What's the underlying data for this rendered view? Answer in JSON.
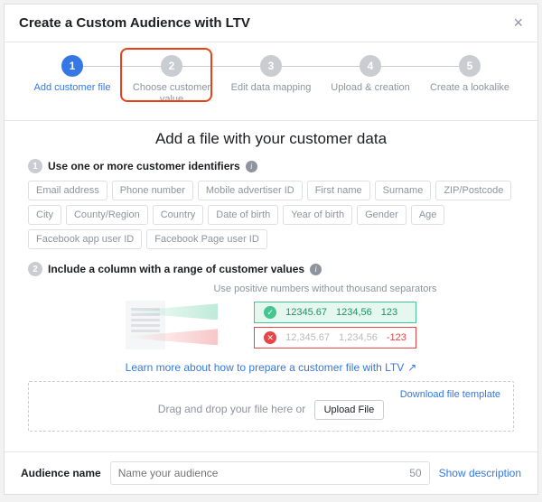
{
  "header": {
    "title": "Create a Custom Audience with LTV"
  },
  "steps": [
    {
      "label": "Add customer file"
    },
    {
      "label": "Choose customer value"
    },
    {
      "label": "Edit data mapping"
    },
    {
      "label": "Upload & creation"
    },
    {
      "label": "Create a lookalike"
    }
  ],
  "main": {
    "title": "Add a file with your customer data",
    "section1": "Use one or more customer identifiers",
    "chips": [
      "Email address",
      "Phone number",
      "Mobile advertiser ID",
      "First name",
      "Surname",
      "ZIP/Postcode",
      "City",
      "County/Region",
      "Country",
      "Date of birth",
      "Year of birth",
      "Gender",
      "Age",
      "Facebook app user ID",
      "Facebook Page user ID"
    ],
    "section2": "Include a column with a range of customer values",
    "example_hint": "Use positive numbers without thousand separators",
    "good_vals": [
      "12345.67",
      "1234,56",
      "123"
    ],
    "bad_vals": [
      "12,345.67",
      "1,234,56",
      "-123"
    ],
    "learn_more": "Learn more about how to prepare a customer file with LTV",
    "download_template": "Download file template",
    "drop_text": "Drag and drop your file here or",
    "upload_btn": "Upload File"
  },
  "footer": {
    "label": "Audience name",
    "placeholder": "Name your audience",
    "limit": "50",
    "show_desc": "Show description"
  }
}
